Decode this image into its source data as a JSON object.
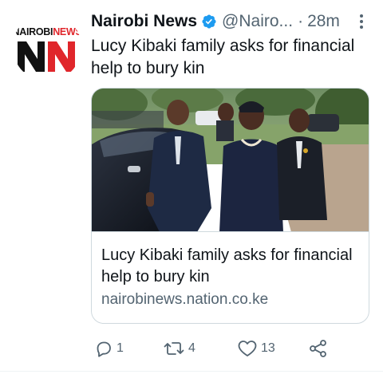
{
  "account": {
    "display_name": "Nairobi News",
    "handle": "@Nairo...",
    "separator": "·",
    "time": "28m",
    "verified": true,
    "avatar_text": "NAIROBINEWS",
    "avatar_monogram": "NN",
    "avatar_colors": {
      "n1": "#111111",
      "n2": "#e0262b",
      "wordmark": "#111111"
    }
  },
  "tweet": {
    "text": "Lucy Kibaki family asks for financial help to bury kin"
  },
  "link_card": {
    "title": "Lucy Kibaki family asks for financial help to bury kin",
    "domain": "nairobinews.nation.co.ke"
  },
  "actions": {
    "reply_count": "1",
    "retweet_count": "4",
    "like_count": "13"
  },
  "colors": {
    "text_primary": "#0f1419",
    "text_secondary": "#536471",
    "verified_blue": "#1d9bf0",
    "border": "#cfd9de"
  },
  "icons": [
    "verified-badge-icon",
    "more-options-icon",
    "reply-icon",
    "retweet-icon",
    "like-icon",
    "share-icon"
  ]
}
